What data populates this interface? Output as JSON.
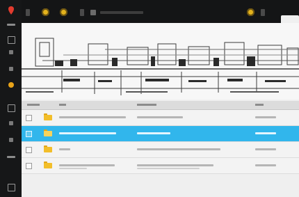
{
  "window": {
    "title": "",
    "accent": "#31b6ec",
    "warning_yellow": "#e4b31d",
    "background": "#141516"
  },
  "rail": {
    "items": [
      {
        "name": "logo-icon"
      },
      {
        "name": "menu-icon"
      },
      {
        "name": "files-icon"
      },
      {
        "name": "upload-icon"
      },
      {
        "name": "settings-icon"
      },
      {
        "name": "status-icon"
      },
      {
        "name": "folder-icon"
      },
      {
        "name": "share-icon"
      },
      {
        "name": "user-icon"
      },
      {
        "name": "logout-icon"
      }
    ]
  },
  "toolbar": {
    "breadcrumb": "",
    "tabs": [
      {
        "label": ""
      }
    ]
  },
  "list": {
    "columns": [
      "",
      "",
      "",
      "",
      ""
    ],
    "rows": [
      {
        "name": "",
        "size": "",
        "date": "",
        "selected": false
      },
      {
        "name": "",
        "size": "",
        "date": "",
        "selected": true
      },
      {
        "name": "",
        "size": "",
        "date": "",
        "selected": false
      },
      {
        "name": "",
        "size": "",
        "date": "",
        "selected": false
      }
    ]
  }
}
